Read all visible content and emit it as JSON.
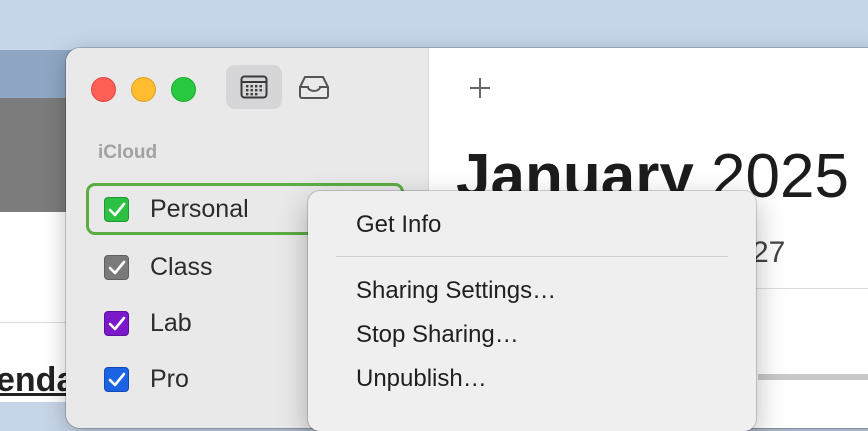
{
  "background_window": {
    "partial_text": "enda"
  },
  "toolbar": {
    "calendar_view_icon": "calendar-icon",
    "inbox_icon": "inbox-tray-icon"
  },
  "sidebar": {
    "section_title": "iCloud",
    "calendars": [
      {
        "label": "Personal",
        "checked": true,
        "color": "#2ec043",
        "selected": true
      },
      {
        "label": "Class",
        "checked": true,
        "color": "#7a7a7a",
        "selected": false
      },
      {
        "label": "Lab",
        "checked": true,
        "color": "#7b18c9",
        "selected": false
      },
      {
        "label": "Pro",
        "checked": true,
        "color": "#1c63e3",
        "selected": false
      }
    ]
  },
  "main": {
    "add_button_icon": "plus-icon",
    "month": "January",
    "year": "2025",
    "visible_day": "27"
  },
  "context_menu": {
    "items": [
      {
        "label": "Get Info"
      },
      {
        "label": "Sharing Settings…"
      },
      {
        "label": "Stop Sharing…"
      },
      {
        "label": "Unpublish…"
      }
    ]
  },
  "colors": {
    "selection_outline": "#5cac44",
    "close": "#fe5f57",
    "minimize": "#febc2e",
    "maximize": "#28c840"
  }
}
